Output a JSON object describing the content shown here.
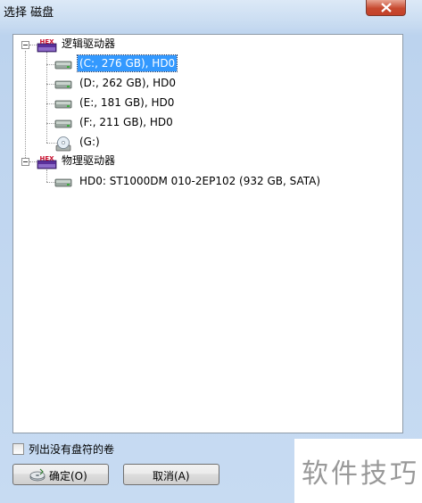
{
  "window": {
    "title": "选择 磁盘"
  },
  "tree": {
    "logical_group": {
      "label": "逻辑驱动器",
      "icon": "hex-drive-icon",
      "drives": [
        {
          "label": "(C:, 276 GB), HD0",
          "icon": "hard-disk-icon",
          "selected": true
        },
        {
          "label": "(D:, 262 GB), HD0",
          "icon": "hard-disk-icon",
          "selected": false
        },
        {
          "label": "(E:, 181 GB), HD0",
          "icon": "hard-disk-icon",
          "selected": false
        },
        {
          "label": "(F:, 211 GB), HD0",
          "icon": "hard-disk-icon",
          "selected": false
        },
        {
          "label": "(G:)",
          "icon": "cd-drive-icon",
          "selected": false
        }
      ]
    },
    "physical_group": {
      "label": "物理驱动器",
      "icon": "hex-drive-icon",
      "drives": [
        {
          "label": "HD0: ST1000DM 010-2EP102 (932 GB, SATA)",
          "icon": "hard-disk-icon",
          "selected": false
        }
      ]
    }
  },
  "options": {
    "list_no_letter_label": "列出没有盘符的卷",
    "list_no_letter_checked": false
  },
  "buttons": {
    "ok_label": "确定(O)",
    "cancel_label": "取消(A)"
  },
  "watermark": {
    "text": "软件技巧"
  },
  "colors": {
    "selection": "#3399ff",
    "window_frame": "#c9dcf1",
    "close_button": "#c74a2f"
  }
}
